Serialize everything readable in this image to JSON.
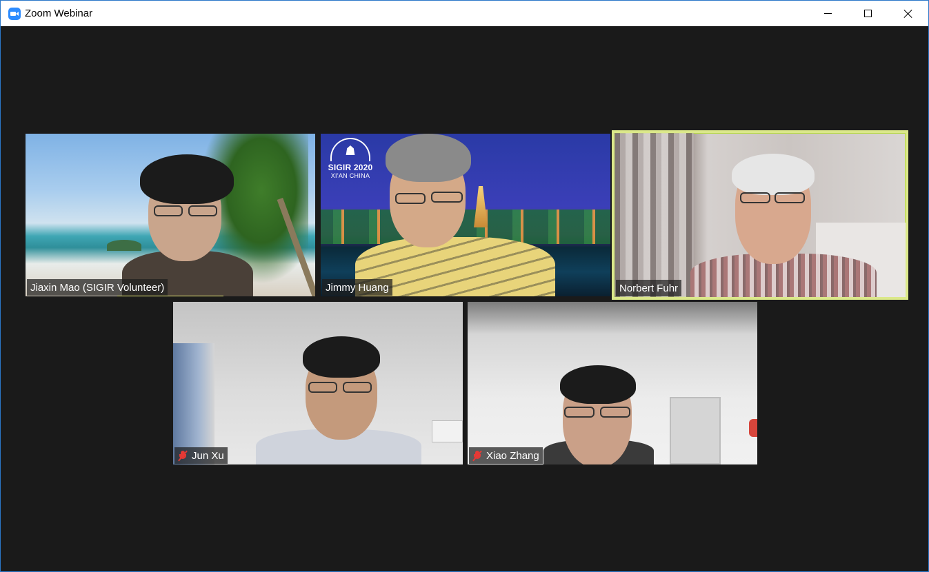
{
  "window": {
    "title": "Zoom Webinar",
    "minimize_icon": "minimize-icon",
    "maximize_icon": "maximize-icon",
    "close_icon": "close-icon",
    "accent_color": "#2d8cff"
  },
  "participants": [
    {
      "name": "Jiaxin Mao (SIGIR Volunteer)",
      "muted": false,
      "speaking": true
    },
    {
      "name": "Jimmy Huang",
      "muted": false,
      "speaking": false,
      "background_logo": {
        "line1": "SIGIR 2020",
        "line2": "XI'AN CHINA"
      }
    },
    {
      "name": "Norbert Fuhr",
      "muted": false,
      "active_speaker": true
    },
    {
      "name": "Jun Xu",
      "muted": true
    },
    {
      "name": "Xiao Zhang",
      "muted": true
    }
  ],
  "colors": {
    "active_speaker_border": "#dbe88a",
    "speaking_indicator": "#f3f57a",
    "muted_icon": "#e53935"
  }
}
